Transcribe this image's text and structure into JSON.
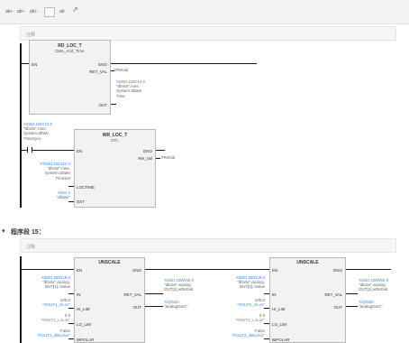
{
  "toolbar": {
    "items": [
      "ab⊢",
      "ab⊢",
      "ab⊢",
      "▭",
      "ab",
      "↗"
    ]
  },
  "network14": {
    "comment_label": "注释",
    "rd_loc_t": {
      "title": "RD_LOC_T",
      "subtitle": "Date_And_Time",
      "pin_en": "EN",
      "pin_eno": "ENO",
      "pin_ret_val": "RET_VAL",
      "ret_val_operand": "#Retval",
      "pin_out": "OUT",
      "out_operand_lines": [
        "%DB1.DBD14.0",
        "\"dbVar\".mes.",
        "System.dDate",
        "Time"
      ]
    },
    "contact": {
      "operand_lines": [
        "%DB1.DBX10.0",
        "\"dbVar\".mes.",
        "System.dbWe",
        "TimeSync"
      ]
    },
    "wr_loc_t": {
      "title": "WR_LOC_T",
      "subtitle": "DTL",
      "pin_en": "EN",
      "pin_eno": "ENO",
      "pin_ret_val": "Ret_Val",
      "ret_val_operand": "#Retval",
      "pin_loctime": "LOCTIME",
      "loctime_operand_lines": [
        "P#DB1.DBX22.0",
        "\"dbVar\".mes.",
        "System.dDate",
        "TimeSet"
      ],
      "pin_dst": "DST",
      "dst_operand_lines": [
        "%M1.1",
        "\"dfalse\""
      ]
    }
  },
  "network15": {
    "arrow": "▾",
    "title": "程序段 15：",
    "comment_label": "注释",
    "unscale1": {
      "title": "UNSCALE",
      "pin_en": "EN",
      "pin_eno": "ENO",
      "pin_in": "IN",
      "in_operand_lines": [
        "%DB1.DBD18.0",
        "\"dbVar\".analog.",
        "OUT[1].rValue"
      ],
      "pin_ret_val": "RET_VAL",
      "ret_val_operand_lines": [
        "%DB1.DBW36.0",
        "\"dbVar\".analog.",
        "OUT[1].wRetVal"
      ],
      "pin_out": "OUT",
      "out_operand_lines": [
        "%QW64",
        "\"analogOut1\""
      ],
      "pin_hi": "HI_LIM",
      "hi_operand_lines": [
        "100.0",
        "\"#OUT1_HLim\""
      ],
      "pin_lo": "LO_LIM",
      "lo_operand_lines": [
        "0.0",
        "\"#OUT1_LoLim\""
      ],
      "pin_bip": "BIPOLAR",
      "bip_operand_lines": [
        "False",
        "\"#OUT1_dBipolar\""
      ]
    },
    "unscale2": {
      "title": "UNSCALE",
      "pin_en": "EN",
      "pin_eno": "ENO",
      "pin_in": "IN",
      "in_operand_lines": [
        "%DB1.DBD18.0",
        "\"dbVar\".analog.",
        "OUT[2].rValue"
      ],
      "pin_ret_val": "RET_VAL",
      "ret_val_operand_lines": [
        "%DB1.DBW56.0",
        "\"dbVar\".analog.",
        "OUT[2].wRetVal"
      ],
      "pin_out": "OUT",
      "out_operand_lines": [
        "%QW66",
        "\"analogOut1\""
      ],
      "pin_hi": "HI_LIM",
      "hi_operand_lines": [
        "100.0",
        "\"#OUT2_HLim\""
      ],
      "pin_lo": "LO_LIM",
      "lo_operand_lines": [
        "0.0",
        "\"#OUT2_LoLim\""
      ],
      "pin_bip": "BIPOLAR",
      "bip_operand_lines": [
        "False",
        "\"#OUT2_dBipolar\""
      ]
    }
  }
}
